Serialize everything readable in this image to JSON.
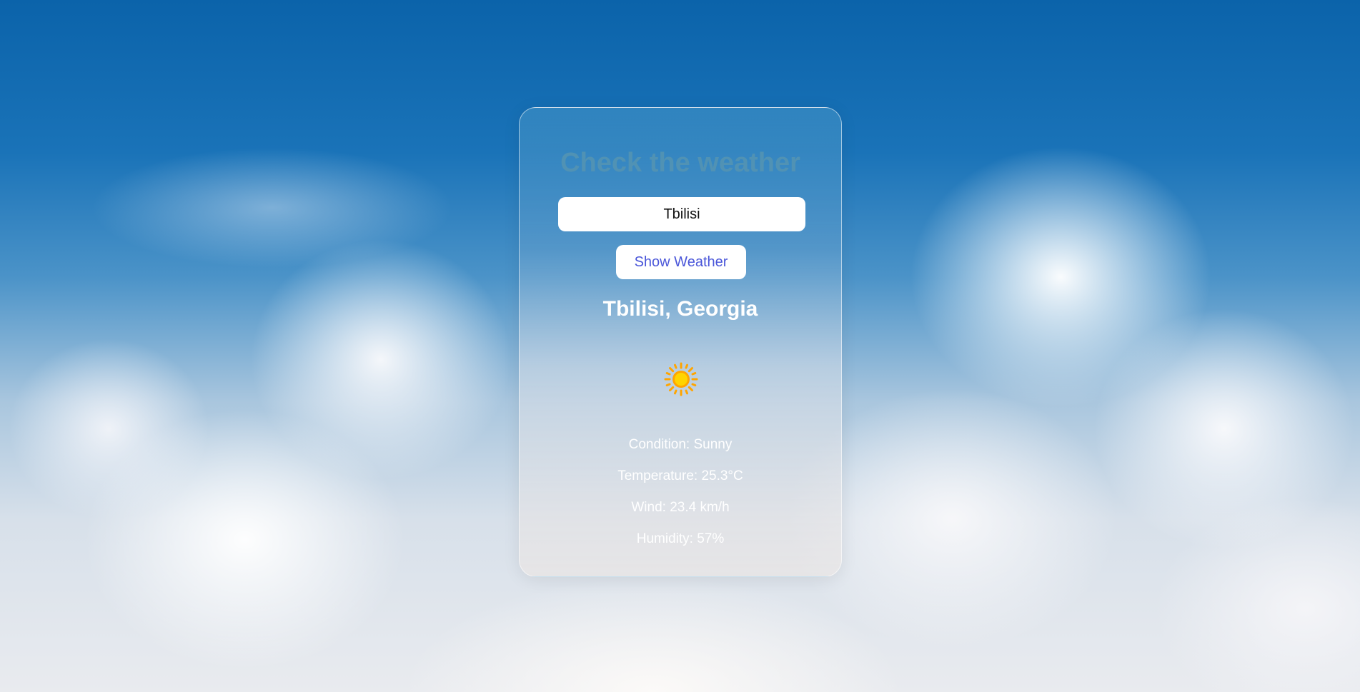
{
  "header": {
    "title": "Check the weather"
  },
  "search": {
    "value": "Tbilisi",
    "button_label": "Show Weather"
  },
  "result": {
    "location": "Tbilisi, Georgia",
    "icon": "sun-icon",
    "condition": "Condition: Sunny",
    "temperature": "Temperature: 25.3°C",
    "wind": "Wind: 23.4 km/h",
    "humidity": "Humidity: 57%"
  },
  "colors": {
    "button_text": "#4a56d9",
    "sun_core": "#ffd400",
    "sun_rays": "#ffa500"
  }
}
